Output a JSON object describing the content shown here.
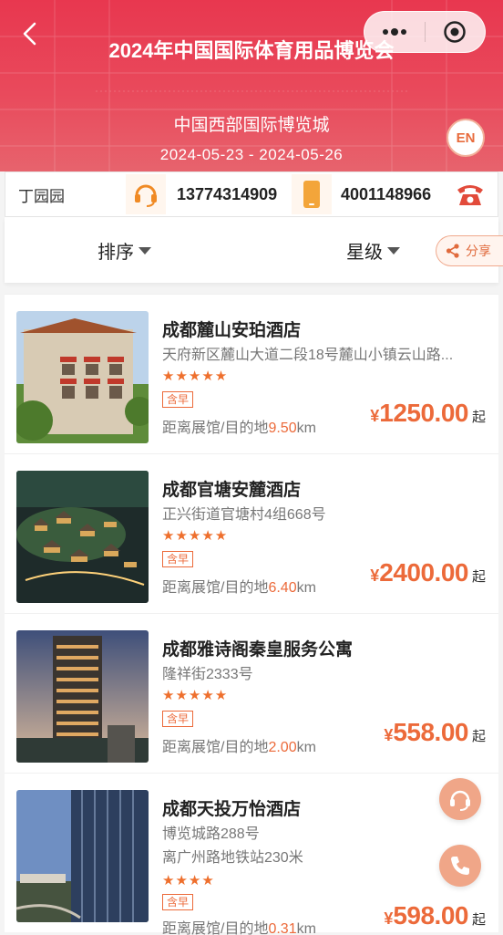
{
  "header": {
    "title": "2024年中国国际体育用品博览会",
    "venue": "中国西部国际博览城",
    "dates": "2024-05-23 - 2024-05-26",
    "lang_button": "EN"
  },
  "contact": {
    "name": "丁园园",
    "mobile": "13774314909",
    "hotline": "4001148966"
  },
  "sortbar": {
    "sort_label": "排序",
    "star_label": "星级",
    "share_label": "分享"
  },
  "hotels": [
    {
      "name": "成都麓山安珀酒店",
      "address": "天府新区麓山大道二段18号麓山小镇云山路...",
      "address2": "",
      "stars": "★★★★★",
      "tag": "含早",
      "distance_label": "距离展馆/目的地",
      "distance_value": "9.50",
      "distance_unit": "km",
      "currency": "¥",
      "price": "1250.00",
      "price_suffix": "起"
    },
    {
      "name": "成都官塘安麓酒店",
      "address": "正兴街道官塘村4组668号",
      "address2": "",
      "stars": "★★★★★",
      "tag": "含早",
      "distance_label": "距离展馆/目的地",
      "distance_value": "6.40",
      "distance_unit": "km",
      "currency": "¥",
      "price": "2400.00",
      "price_suffix": "起"
    },
    {
      "name": "成都雅诗阁秦皇服务公寓",
      "address": "隆祥街2333号",
      "address2": "",
      "stars": "★★★★★",
      "tag": "含早",
      "distance_label": "距离展馆/目的地",
      "distance_value": "2.00",
      "distance_unit": "km",
      "currency": "¥",
      "price": "558.00",
      "price_suffix": "起"
    },
    {
      "name": "成都天投万怡酒店",
      "address": "博览城路288号",
      "address2": "离广州路地铁站230米",
      "stars": "★★★★",
      "tag": "含早",
      "distance_label": "距离展馆/目的地",
      "distance_value": "0.31",
      "distance_unit": "km",
      "currency": "¥",
      "price": "598.00",
      "price_suffix": "起"
    }
  ],
  "icons": {
    "back": "chevron-left-icon",
    "more": "more-dots-icon",
    "close": "target-icon",
    "headset": "headset-icon",
    "mobile": "mobile-phone-icon",
    "telephone": "telephone-icon",
    "share": "share-icon",
    "float_service": "customer-service-icon",
    "float_call": "call-icon"
  },
  "colors": {
    "banner": "#e8374f",
    "accent": "#ec6a3a",
    "float_button": "#f0a688"
  }
}
